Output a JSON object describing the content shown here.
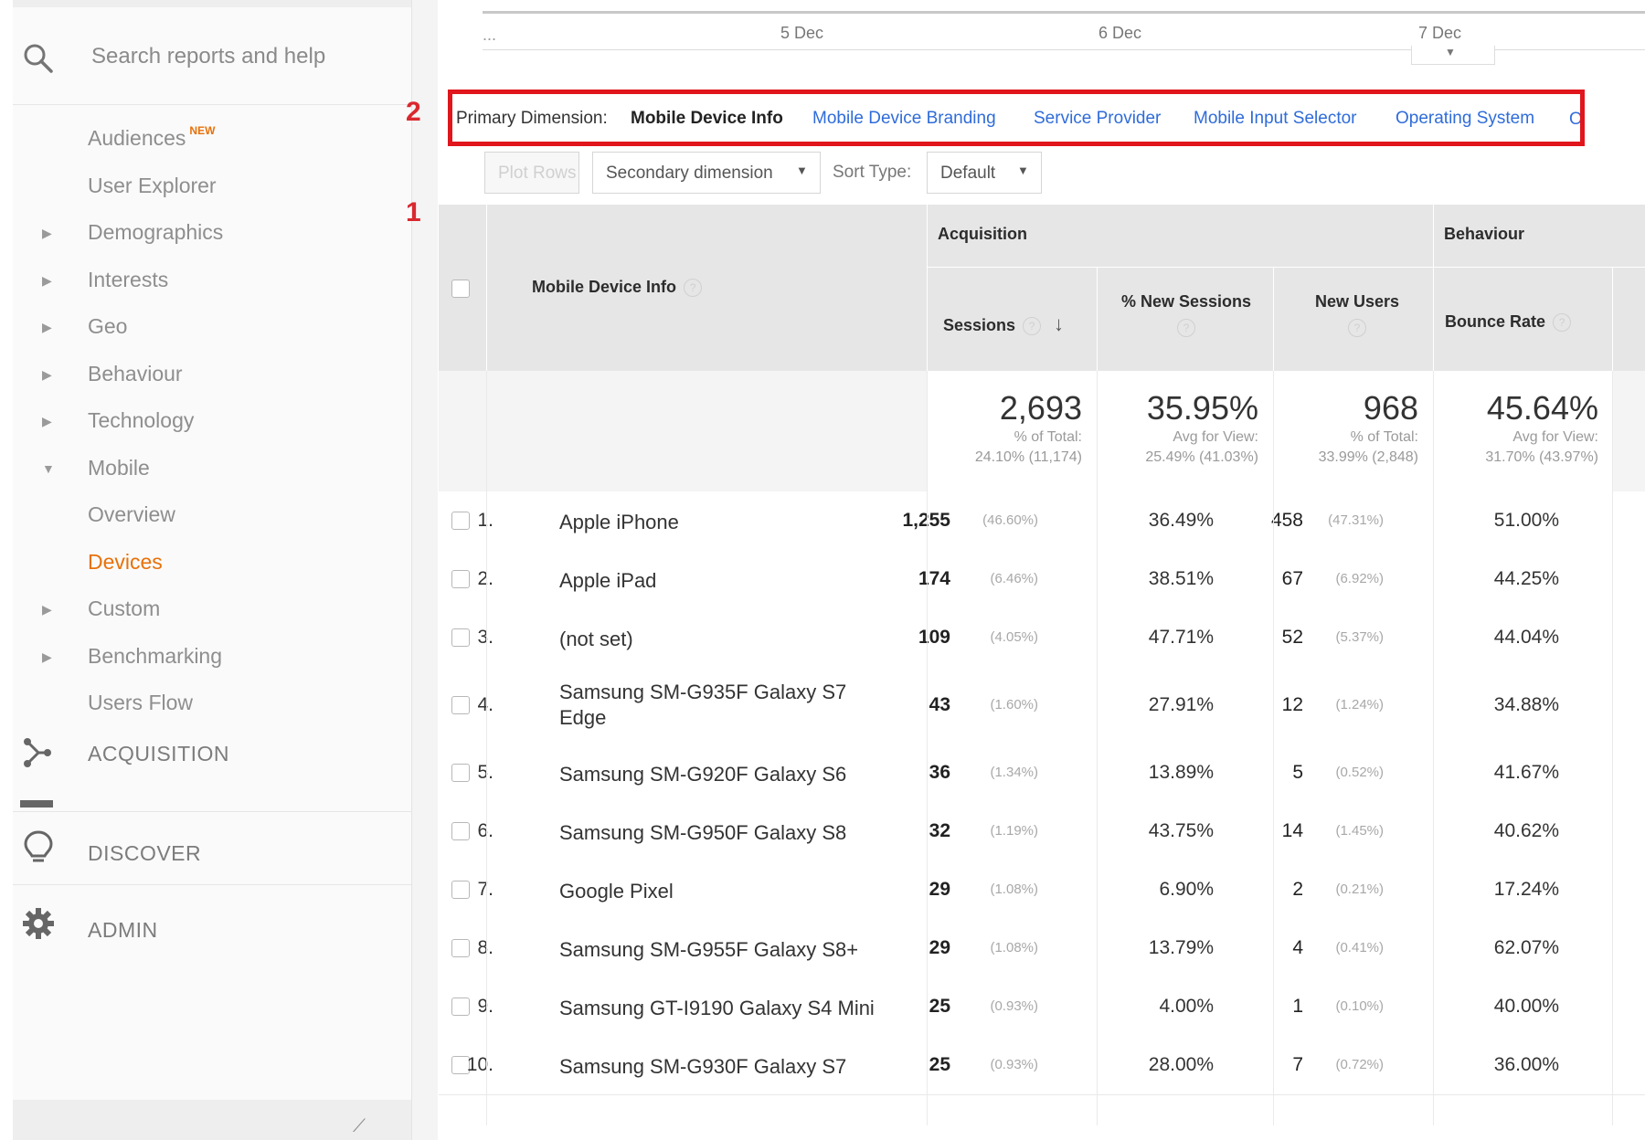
{
  "sidebar": {
    "search_placeholder": "Search reports and help",
    "items": [
      {
        "label": "Audiences",
        "badge": "NEW",
        "arrow": ""
      },
      {
        "label": "User Explorer",
        "arrow": ""
      },
      {
        "label": "Demographics",
        "arrow": "▶"
      },
      {
        "label": "Interests",
        "arrow": "▶"
      },
      {
        "label": "Geo",
        "arrow": "▶"
      },
      {
        "label": "Behaviour",
        "arrow": "▶"
      },
      {
        "label": "Technology",
        "arrow": "▶"
      },
      {
        "label": "Mobile",
        "arrow": "▼"
      },
      {
        "label": "Overview",
        "arrow": ""
      },
      {
        "label": "Devices",
        "arrow": ""
      },
      {
        "label": "Custom",
        "arrow": "▶"
      },
      {
        "label": "Benchmarking",
        "arrow": "▶"
      },
      {
        "label": "Users Flow",
        "arrow": ""
      }
    ],
    "active_item": "Devices",
    "sections": [
      {
        "label": "ACQUISITION",
        "icon": "acquisition-icon"
      },
      {
        "label": "DISCOVER",
        "icon": "lightbulb-icon"
      },
      {
        "label": "ADMIN",
        "icon": "gear-icon"
      }
    ]
  },
  "timeline": {
    "ellipsis": "...",
    "ticks": [
      "5 Dec",
      "6 Dec",
      "7 Dec"
    ]
  },
  "annotations": {
    "one": "1",
    "two": "2",
    "color": "#e0161c"
  },
  "dimensions": {
    "label": "Primary Dimension:",
    "current": "Mobile Device Info",
    "links": [
      "Mobile Device Branding",
      "Service Provider",
      "Mobile Input Selector",
      "Operating System",
      "Other"
    ]
  },
  "toolbar": {
    "plot_rows": "Plot Rows",
    "secondary_dimension": "Secondary dimension",
    "sort_type_label": "Sort Type:",
    "sort_type_value": "Default"
  },
  "table": {
    "group_acquisition": "Acquisition",
    "group_behaviour": "Behaviour",
    "col_dimension": "Mobile Device Info",
    "col_sessions": "Sessions",
    "col_new_sessions": "% New Sessions",
    "col_new_users": "New Users",
    "col_bounce": "Bounce Rate",
    "totals": {
      "sessions": {
        "value": "2,693",
        "line1": "% of Total:",
        "line2": "24.10% (11,174)"
      },
      "new_sessions": {
        "value": "35.95%",
        "line1": "Avg for View:",
        "line2": "25.49% (41.03%)"
      },
      "new_users": {
        "value": "968",
        "line1": "% of Total:",
        "line2": "33.99% (2,848)"
      },
      "bounce": {
        "value": "45.64%",
        "line1": "Avg for View:",
        "line2": "31.70% (43.97%)"
      }
    },
    "rows": [
      {
        "num": "1.",
        "name": "Apple iPhone",
        "sessions": "1,255",
        "sessions_pct": "(46.60%)",
        "new_sessions": "36.49%",
        "new_users": "458",
        "new_users_pct": "(47.31%)",
        "bounce": "51.00%"
      },
      {
        "num": "2.",
        "name": "Apple iPad",
        "sessions": "174",
        "sessions_pct": "(6.46%)",
        "new_sessions": "38.51%",
        "new_users": "67",
        "new_users_pct": "(6.92%)",
        "bounce": "44.25%"
      },
      {
        "num": "3.",
        "name": "(not set)",
        "sessions": "109",
        "sessions_pct": "(4.05%)",
        "new_sessions": "47.71%",
        "new_users": "52",
        "new_users_pct": "(5.37%)",
        "bounce": "44.04%"
      },
      {
        "num": "4.",
        "name": "Samsung SM-G935F Galaxy S7 Edge",
        "sessions": "43",
        "sessions_pct": "(1.60%)",
        "new_sessions": "27.91%",
        "new_users": "12",
        "new_users_pct": "(1.24%)",
        "bounce": "34.88%"
      },
      {
        "num": "5.",
        "name": "Samsung SM-G920F Galaxy S6",
        "sessions": "36",
        "sessions_pct": "(1.34%)",
        "new_sessions": "13.89%",
        "new_users": "5",
        "new_users_pct": "(0.52%)",
        "bounce": "41.67%"
      },
      {
        "num": "6.",
        "name": "Samsung SM-G950F Galaxy S8",
        "sessions": "32",
        "sessions_pct": "(1.19%)",
        "new_sessions": "43.75%",
        "new_users": "14",
        "new_users_pct": "(1.45%)",
        "bounce": "40.62%"
      },
      {
        "num": "7.",
        "name": "Google Pixel",
        "sessions": "29",
        "sessions_pct": "(1.08%)",
        "new_sessions": "6.90%",
        "new_users": "2",
        "new_users_pct": "(0.21%)",
        "bounce": "17.24%"
      },
      {
        "num": "8.",
        "name": "Samsung SM-G955F Galaxy S8+",
        "sessions": "29",
        "sessions_pct": "(1.08%)",
        "new_sessions": "13.79%",
        "new_users": "4",
        "new_users_pct": "(0.41%)",
        "bounce": "62.07%"
      },
      {
        "num": "9.",
        "name": "Samsung GT-I9190 Galaxy S4 Mini",
        "sessions": "25",
        "sessions_pct": "(0.93%)",
        "new_sessions": "4.00%",
        "new_users": "1",
        "new_users_pct": "(0.10%)",
        "bounce": "40.00%"
      },
      {
        "num": "10.",
        "name": "Samsung SM-G930F Galaxy S7",
        "sessions": "25",
        "sessions_pct": "(0.93%)",
        "new_sessions": "28.00%",
        "new_users": "7",
        "new_users_pct": "(0.72%)",
        "bounce": "36.00%"
      }
    ]
  }
}
